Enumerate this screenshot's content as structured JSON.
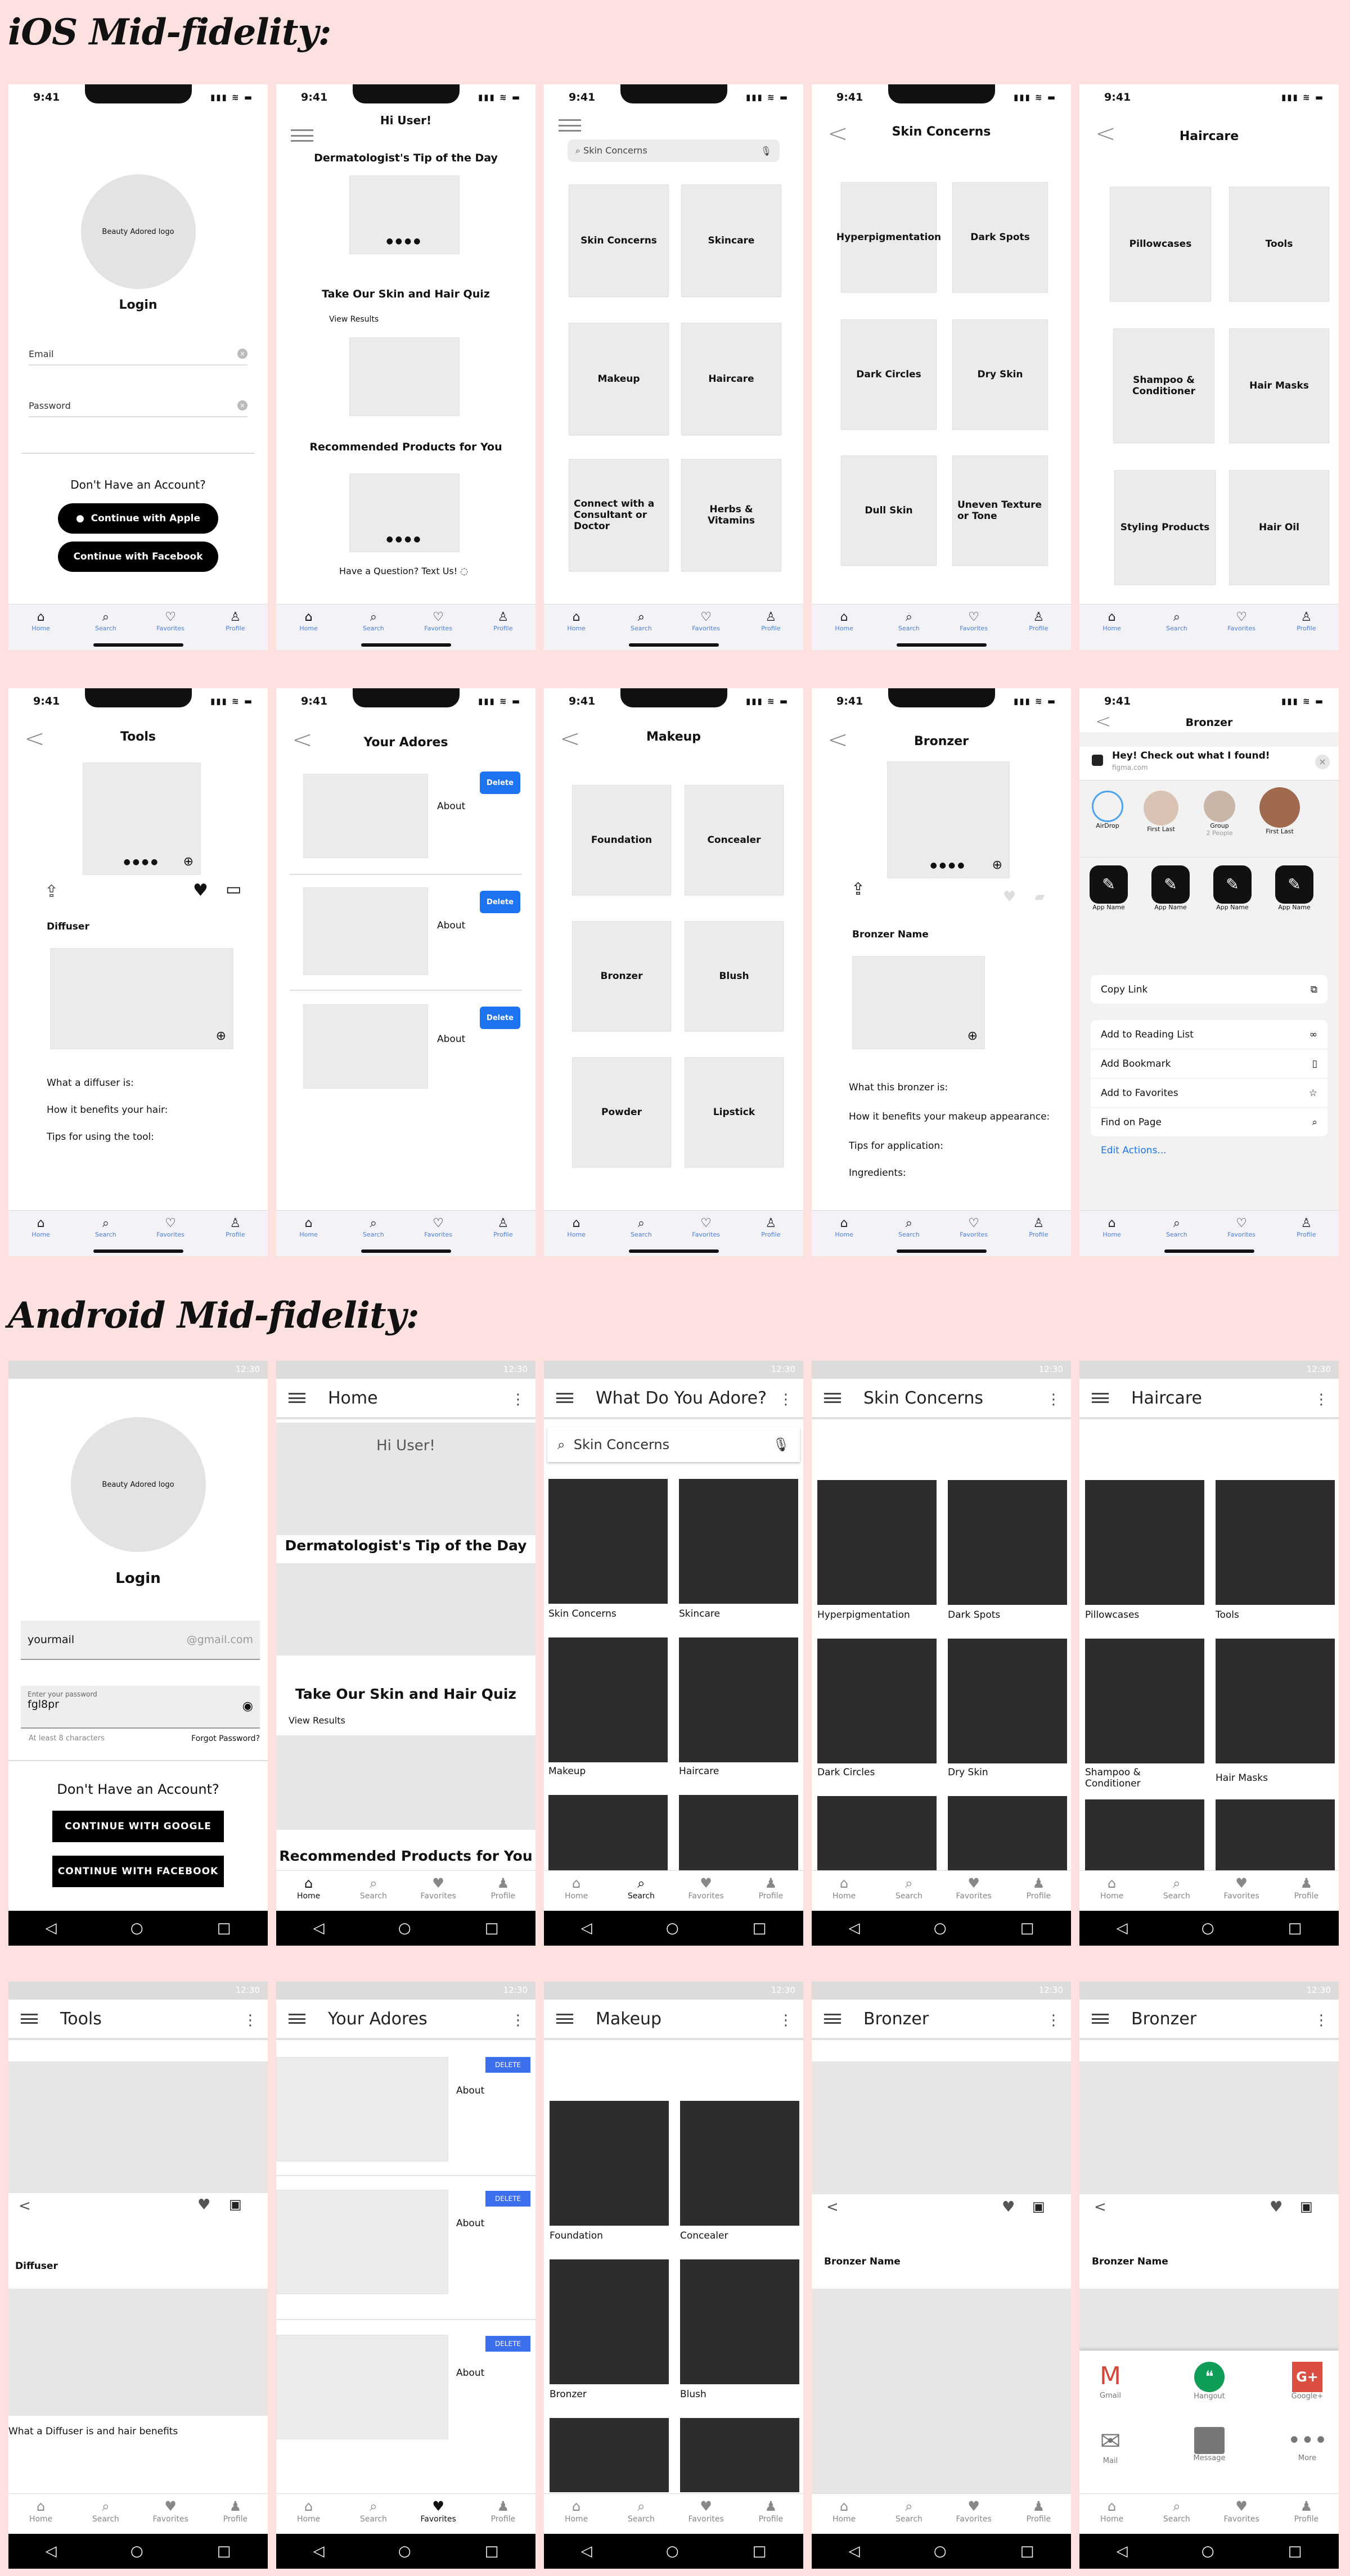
{
  "sections": {
    "ios_title": "iOS Mid-fidelity:",
    "android_title": "Android Mid-fidelity:"
  },
  "ios": {
    "time": "9:41",
    "tabs": [
      "Home",
      "Search",
      "Favorites",
      "Profile"
    ],
    "login": {
      "logo": "Beauty Adored logo",
      "title": "Login",
      "email": "Email",
      "password": "Password",
      "no_account": "Don't Have an Account?",
      "apple": "Continue with Apple",
      "facebook": "Continue with Facebook"
    },
    "home": {
      "greeting": "Hi User!",
      "tip": "Dermatologist's Tip of the Day",
      "quiz": "Take Our Skin and Hair Quiz",
      "view_results": "View Results",
      "recommended": "Recommended Products for You",
      "question": "Have a Question? Text Us!"
    },
    "search": {
      "query": "Skin Concerns",
      "tiles": [
        "Skin Concerns",
        "Skincare",
        "Makeup",
        "Haircare",
        "Connect with a Consultant or Doctor",
        "Herbs & Vitamins"
      ]
    },
    "skin": {
      "title": "Skin Concerns",
      "tiles": [
        "Hyperpigmentation",
        "Dark Spots",
        "Dark Circles",
        "Dry Skin",
        "Dull Skin",
        "Uneven Texture or Tone"
      ]
    },
    "haircare": {
      "title": "Haircare",
      "tiles": [
        "Pillowcases",
        "Tools",
        "Shampoo & Conditioner",
        "Hair Masks",
        "Styling Products",
        "Hair Oil"
      ]
    },
    "tools": {
      "title": "Tools",
      "product": "Diffuser",
      "l1": "What a diffuser is:",
      "l2": "How it benefits your hair:",
      "l3": "Tips for using the tool:"
    },
    "adores": {
      "title": "Your Adores",
      "about": "About",
      "delete": "Delete"
    },
    "makeup": {
      "title": "Makeup",
      "tiles": [
        "Foundation",
        "Concealer",
        "Bronzer",
        "Blush",
        "Powder",
        "Lipstick"
      ]
    },
    "bronzer": {
      "title": "Bronzer",
      "name": "Bronzer Name",
      "l1": "What this bronzer is:",
      "l2": "How it benefits your makeup appearance:",
      "l3": "Tips for application:",
      "l4": "Ingredients:"
    },
    "share": {
      "title": "Bronzer",
      "msg": "Hey! Check out what I found!",
      "site": "figma.com",
      "contacts": [
        "AirDrop",
        "First Last",
        "Group",
        "First Last"
      ],
      "group_sub": "2 People",
      "app": "App Name",
      "rows": [
        "Copy Link",
        "Add to Reading List",
        "Add Bookmark",
        "Add to Favorites",
        "Find on Page"
      ],
      "edit": "Edit Actions..."
    }
  },
  "android": {
    "clock": "12:30",
    "tabs": [
      "Home",
      "Search",
      "Favorites",
      "Profile"
    ],
    "login": {
      "logo": "Beauty Adored logo",
      "title": "Login",
      "user": "yourmail",
      "domain": "@gmail.com",
      "pw_label": "Enter your password",
      "pw_value": "fgl8pr",
      "hint": "At least 8 characters",
      "forgot": "Forgot Password?",
      "no_account": "Don't Have an Account?",
      "google": "CONTINUE WITH GOOGLE",
      "facebook": "CONTINUE WITH FACEBOOK"
    },
    "home": {
      "title": "Home",
      "greeting": "Hi User!",
      "tip": "Dermatologist's Tip of the Day",
      "quiz": "Take Our Skin and Hair Quiz",
      "view_results": "View Results",
      "recommended": "Recommended Products for You"
    },
    "search": {
      "title": "What Do You Adore?",
      "query": "Skin Concerns",
      "tiles": [
        "Skin Concerns",
        "Skincare",
        "Makeup",
        "Haircare"
      ]
    },
    "skin": {
      "title": "Skin Concerns",
      "tiles": [
        "Hyperpigmentation",
        "Dark Spots",
        "Dark Circles",
        "Dry Skin"
      ]
    },
    "haircare": {
      "title": "Haircare",
      "tiles": [
        "Pillowcases",
        "Tools",
        "Shampoo & Conditioner",
        "Hair Masks"
      ]
    },
    "tools": {
      "title": "Tools",
      "product": "Diffuser",
      "desc": "What a Diffuser is and hair benefits"
    },
    "adores": {
      "title": "Your Adores",
      "about": "About",
      "delete": "DELETE"
    },
    "makeup": {
      "title": "Makeup",
      "tiles": [
        "Foundation",
        "Concealer",
        "Bronzer",
        "Blush"
      ]
    },
    "bronzer": {
      "title": "Bronzer",
      "name": "Bronzer Name"
    },
    "share": {
      "title": "Bronzer",
      "name": "Bronzer Name",
      "apps": [
        "Gmail",
        "Hangout",
        "Google+",
        "Mail",
        "Message",
        "More"
      ]
    }
  },
  "colors": {
    "background": "#fde0e0",
    "ios_accent": "#1e73f0",
    "android_accent": "#3b6ff0"
  }
}
